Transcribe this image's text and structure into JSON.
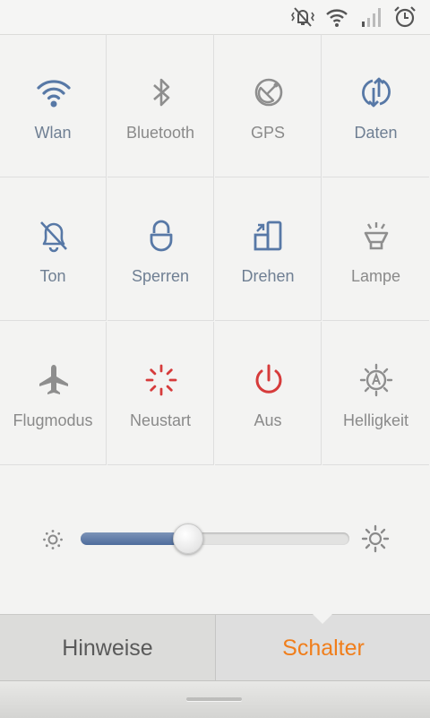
{
  "status_bar": {
    "icons": [
      "vibrate-silent-icon",
      "wifi-icon",
      "signal-icon",
      "alarm-icon"
    ]
  },
  "toggles": [
    {
      "label": "Wlan",
      "icon": "wifi-icon",
      "active": true
    },
    {
      "label": "Bluetooth",
      "icon": "bluetooth-icon",
      "active": false
    },
    {
      "label": "GPS",
      "icon": "gps-icon",
      "active": false
    },
    {
      "label": "Daten",
      "icon": "data-sync-icon",
      "active": true
    },
    {
      "label": "Ton",
      "icon": "bell-muted-icon",
      "active": true
    },
    {
      "label": "Sperren",
      "icon": "lock-icon",
      "active": true
    },
    {
      "label": "Drehen",
      "icon": "rotate-icon",
      "active": true
    },
    {
      "label": "Lampe",
      "icon": "flashlight-icon",
      "active": false
    },
    {
      "label": "Flugmodus",
      "icon": "airplane-icon",
      "active": false
    },
    {
      "label": "Neustart",
      "icon": "reboot-icon",
      "active": false
    },
    {
      "label": "Aus",
      "icon": "power-icon",
      "active": false
    },
    {
      "label": "Helligkeit",
      "icon": "auto-brightness-icon",
      "active": false
    }
  ],
  "brightness": {
    "level_fraction": 0.4
  },
  "tabs": {
    "left": "Hinweise",
    "right": "Schalter",
    "active": "right"
  },
  "colors": {
    "active_icon": "#5778a6",
    "inactive_icon": "#8e8e8e",
    "accent": "#f07e1b",
    "danger": "#d63b3b"
  }
}
